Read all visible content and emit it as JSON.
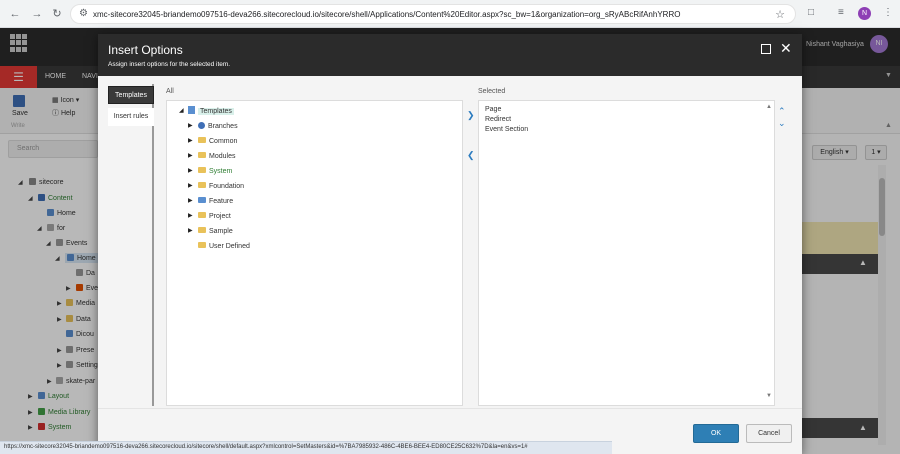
{
  "browser": {
    "url": "xmc-sitecore32045-briandemo097516-deva266.sitecorecloud.io/sitecore/shell/Applications/Content%20Editor.aspx?sc_bw=1&organization=org_sRyABcRifAnhYRRO",
    "profile_initial": "N"
  },
  "app": {
    "user_name": "Nishant Vaghasiya",
    "user_initials": "NI",
    "tabs": [
      "HOME",
      "NAVI"
    ],
    "ribbon": {
      "save": "Save",
      "write": "Write",
      "icon": "Icon",
      "help": "Help"
    },
    "search_placeholder": "Search",
    "language": "English",
    "version": "1",
    "tree": [
      {
        "label": "sitecore"
      },
      {
        "label": "Content"
      },
      {
        "label": "Home"
      },
      {
        "label": "for"
      },
      {
        "label": "Events"
      },
      {
        "label": "Home"
      },
      {
        "label": "Da"
      },
      {
        "label": "Eve"
      },
      {
        "label": "Media"
      },
      {
        "label": "Data"
      },
      {
        "label": "Dicou"
      },
      {
        "label": "Prese"
      },
      {
        "label": "Setting"
      },
      {
        "label": "skate-par"
      },
      {
        "label": "Layout"
      },
      {
        "label": "Media Library"
      },
      {
        "label": "System"
      }
    ]
  },
  "dialog": {
    "title": "Insert Options",
    "subtitle": "Assign insert options for the selected item.",
    "tabs": [
      "Templates",
      "Insert rules"
    ],
    "all_label": "All",
    "selected_label": "Selected",
    "all_tree": [
      {
        "label": "Templates"
      },
      {
        "label": "Branches"
      },
      {
        "label": "Common"
      },
      {
        "label": "Modules"
      },
      {
        "label": "System"
      },
      {
        "label": "Foundation"
      },
      {
        "label": "Feature"
      },
      {
        "label": "Project"
      },
      {
        "label": "Sample"
      },
      {
        "label": "User Defined"
      }
    ],
    "selected_items": [
      "Page",
      "Redirect",
      "Event Section"
    ],
    "ok": "OK",
    "cancel": "Cancel"
  },
  "status_url": "https://xmc-sitecore32045-briandemo097516-deva266.sitecorecloud.io/sitecore/shell/default.aspx?xmlcontrol=SetMasters&id=%7BA7985932-486C-4BE6-BEE4-ED80CE25C632%7D&la=en&vs=1#"
}
